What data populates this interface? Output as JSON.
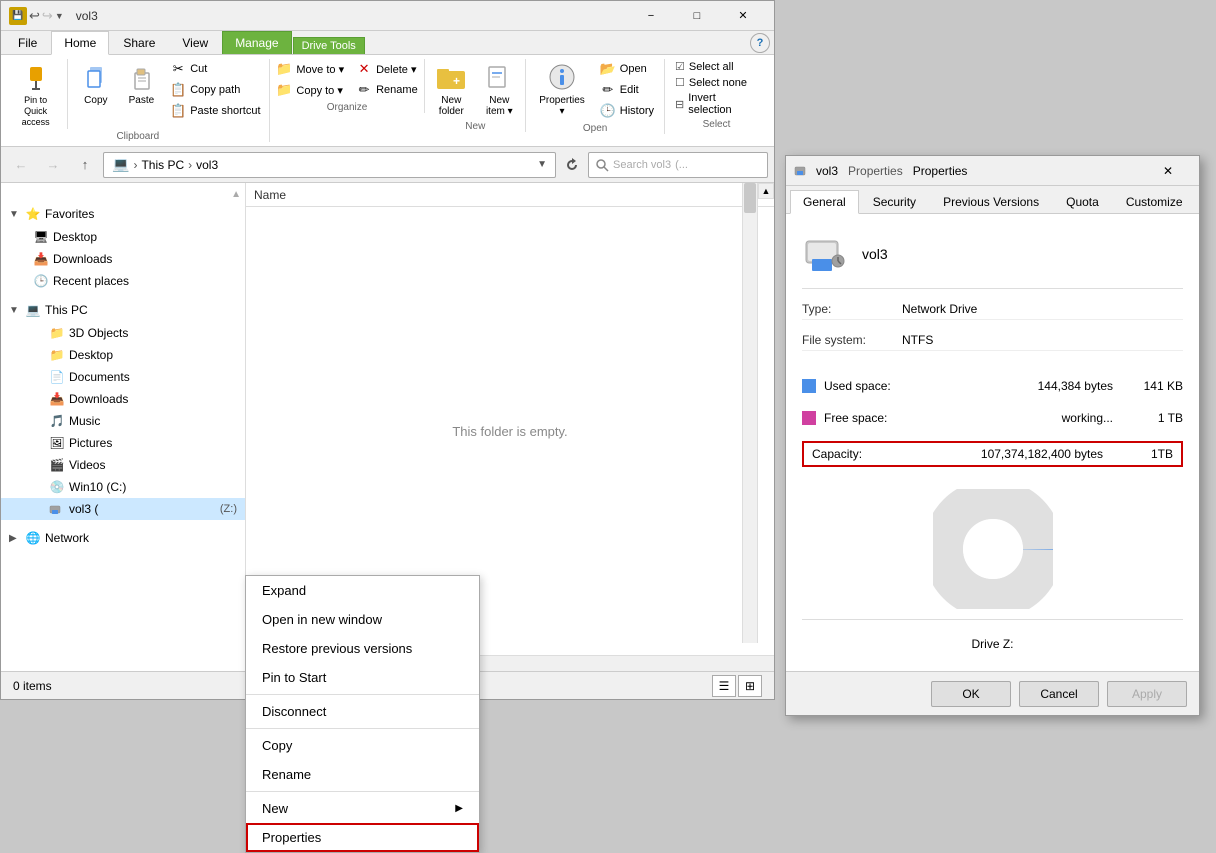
{
  "explorer": {
    "title": "vol3",
    "tabs": [
      "File",
      "Home",
      "Share",
      "View",
      "Manage",
      "Drive Tools"
    ],
    "active_tab": "Home",
    "manage_tab": "Manage",
    "manage_subtitle": "Drive Tools",
    "ribbon": {
      "clipboard_group": "Clipboard",
      "organize_group": "Organize",
      "new_group": "New",
      "open_group": "Open",
      "select_group": "Select",
      "pin_label": "Pin to Quick access",
      "copy_label": "Copy",
      "paste_label": "Paste",
      "cut_label": "Cut",
      "copy_path_label": "Copy path",
      "paste_shortcut_label": "Paste shortcut",
      "move_to_label": "Move to",
      "delete_label": "Delete",
      "rename_label": "Rename",
      "copy_to_label": "Copy to",
      "new_folder_label": "New folder",
      "properties_label": "Properties",
      "select_all_label": "Select all",
      "select_none_label": "Select none",
      "invert_label": "Invert selection"
    },
    "address": {
      "path": "This PC > vol3",
      "search_placeholder": "Search vol3",
      "search_hint": "(..."
    },
    "nav_tree": [
      {
        "label": "Favorites",
        "indent": 0,
        "icon": "⭐",
        "expanded": true,
        "arrow": "▼"
      },
      {
        "label": "Desktop",
        "indent": 1,
        "icon": "🖥",
        "expanded": false,
        "arrow": ""
      },
      {
        "label": "Downloads",
        "indent": 1,
        "icon": "📥",
        "expanded": false,
        "arrow": ""
      },
      {
        "label": "Recent places",
        "indent": 1,
        "icon": "🕒",
        "expanded": false,
        "arrow": ""
      },
      {
        "label": "",
        "indent": 0,
        "separator": true
      },
      {
        "label": "This PC",
        "indent": 0,
        "icon": "💻",
        "expanded": true,
        "arrow": "▼"
      },
      {
        "label": "3D Objects",
        "indent": 1,
        "icon": "📁",
        "expanded": false,
        "arrow": ""
      },
      {
        "label": "Desktop",
        "indent": 1,
        "icon": "📁",
        "expanded": false,
        "arrow": ""
      },
      {
        "label": "Documents",
        "indent": 1,
        "icon": "📄",
        "expanded": false,
        "arrow": ""
      },
      {
        "label": "Downloads",
        "indent": 1,
        "icon": "📥",
        "expanded": false,
        "arrow": ""
      },
      {
        "label": "Music",
        "indent": 1,
        "icon": "🎵",
        "expanded": false,
        "arrow": ""
      },
      {
        "label": "Pictures",
        "indent": 1,
        "icon": "🖼",
        "expanded": false,
        "arrow": ""
      },
      {
        "label": "Videos",
        "indent": 1,
        "icon": "🎬",
        "expanded": false,
        "arrow": ""
      },
      {
        "label": "Win10 (C:)",
        "indent": 1,
        "icon": "💿",
        "expanded": false,
        "arrow": ""
      },
      {
        "label": "vol3 (",
        "indent": 1,
        "icon": "🌐",
        "extra": "(Z:)",
        "expanded": false,
        "arrow": "",
        "selected": true
      },
      {
        "label": "",
        "indent": 0,
        "separator": true
      },
      {
        "label": "Network",
        "indent": 0,
        "icon": "🌐",
        "expanded": false,
        "arrow": "▶"
      }
    ],
    "content": {
      "col_name": "Name",
      "empty_text": "This folder is empty."
    },
    "status": {
      "items": "0 items"
    }
  },
  "context_menu": {
    "items": [
      {
        "label": "Expand",
        "has_sub": false
      },
      {
        "label": "Open in new window",
        "has_sub": false
      },
      {
        "label": "Restore previous versions",
        "has_sub": false
      },
      {
        "label": "Pin to Start",
        "has_sub": false
      },
      {
        "label": "Disconnect",
        "has_sub": false
      },
      {
        "label": "Copy",
        "has_sub": false
      },
      {
        "label": "Rename",
        "has_sub": false
      },
      {
        "label": "New",
        "has_sub": true
      },
      {
        "label": "Properties",
        "has_sub": false,
        "highlighted": true
      }
    ]
  },
  "properties_dialog": {
    "title": "vol3",
    "subtitle": "Properties",
    "tabs": [
      "General",
      "Security",
      "Previous Versions",
      "Quota",
      "Customize"
    ],
    "active_tab": "General",
    "drive_name": "vol3",
    "type_label": "Type:",
    "type_value": "Network Drive",
    "fs_label": "File system:",
    "fs_value": "NTFS",
    "used_label": "Used space:",
    "used_bytes": "144,384 bytes",
    "used_human": "141 KB",
    "free_label": "Free space:",
    "free_bytes": "working...",
    "free_human": "1 TB",
    "capacity_label": "Capacity:",
    "capacity_bytes": "107,374,182,400 bytes",
    "capacity_human": "1TB",
    "drive_label": "Drive Z:",
    "buttons": {
      "ok": "OK",
      "cancel": "Cancel",
      "apply": "Apply"
    }
  }
}
